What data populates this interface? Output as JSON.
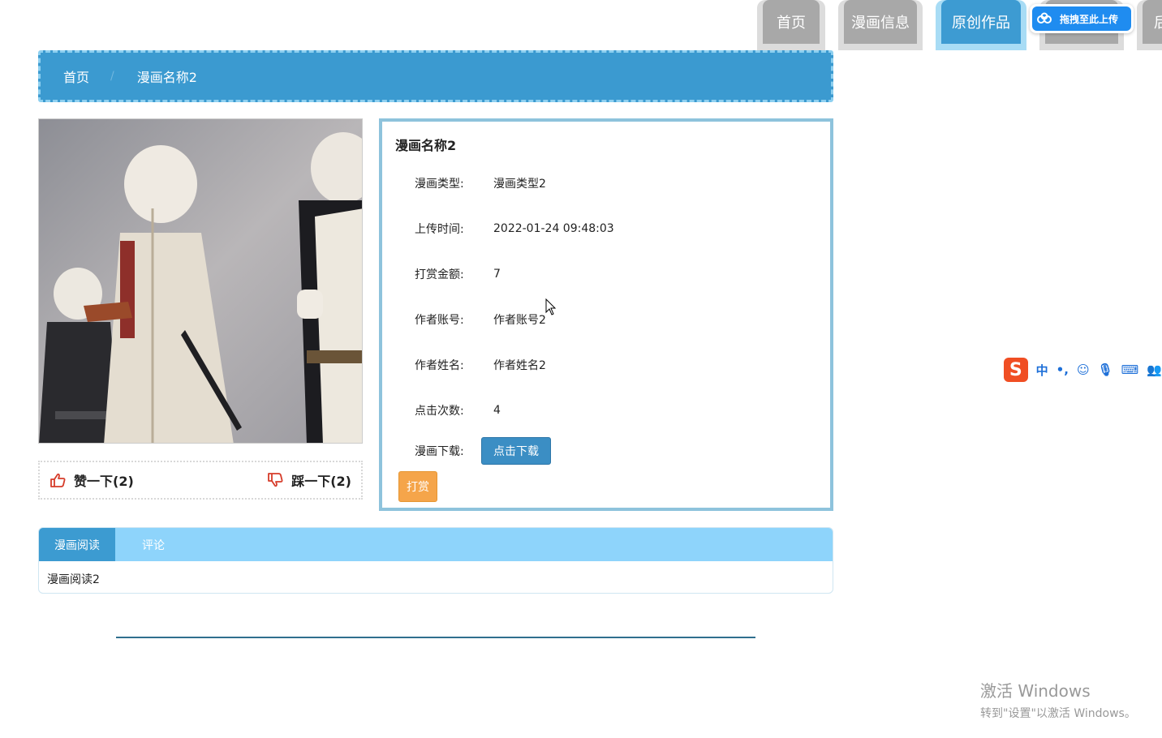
{
  "nav": {
    "tabs": [
      {
        "label": "首页"
      },
      {
        "label": "漫画信息"
      },
      {
        "label": "原创作品"
      },
      {
        "label": ""
      },
      {
        "label": "后台管"
      }
    ]
  },
  "baidu": {
    "label": "拖拽至此上传"
  },
  "breadcrumb": {
    "home": "首页",
    "sep": "/",
    "current": "漫画名称2"
  },
  "votes": {
    "like": "赞一下(2)",
    "dislike": "踩一下(2)"
  },
  "detail": {
    "title": "漫画名称2",
    "rows": [
      {
        "label": "漫画类型:",
        "value": "漫画类型2"
      },
      {
        "label": "上传时间:",
        "value": "2022-01-24 09:48:03"
      },
      {
        "label": "打赏金额:",
        "value": "7"
      },
      {
        "label": "作者账号:",
        "value": "作者账号2"
      },
      {
        "label": "作者姓名:",
        "value": "作者姓名2"
      },
      {
        "label": "点击次数:",
        "value": "4"
      }
    ],
    "download_label": "漫画下载:",
    "download_button": "点击下载",
    "reward_button": "打赏"
  },
  "tabs": {
    "items": [
      {
        "label": "漫画阅读"
      },
      {
        "label": "评论"
      }
    ],
    "content": "漫画阅读2"
  },
  "ime": {
    "logo": "S",
    "lang": "中",
    "punct": "•,"
  },
  "watermark": {
    "title": "激活 Windows",
    "subtitle": "转到\"设置\"以激活 Windows。"
  },
  "colors": {
    "primary": "#3b9ad0",
    "tab_bar": "#8ed4fb",
    "reward": "#f5a54a",
    "nav_gray": "#a8a8a8"
  }
}
